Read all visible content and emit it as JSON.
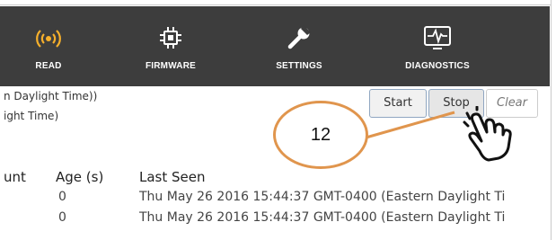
{
  "nav": {
    "items": [
      {
        "label": "READ",
        "icon": "wireless-signal-icon",
        "color": "#f7b02b"
      },
      {
        "label": "FIRMWARE",
        "icon": "chip-icon",
        "color": "#ffffff"
      },
      {
        "label": "SETTINGS",
        "icon": "wrench-icon",
        "color": "#ffffff"
      },
      {
        "label": "DIAGNOSTICS",
        "icon": "monitor-waveform-icon",
        "color": "#ffffff"
      }
    ]
  },
  "timezone_lines": [
    "n Daylight Time))",
    "ight Time)"
  ],
  "buttons": {
    "start_label": "Start",
    "stop_label": "Stop",
    "clear_label": "Clear"
  },
  "callout": {
    "number": "12",
    "border_color": "#e0954d"
  },
  "table": {
    "headers": [
      "unt",
      "Age (s)",
      "Last Seen"
    ],
    "rows": [
      {
        "age": "0",
        "last_seen": "Thu May 26 2016 15:44:37 GMT-0400 (Eastern Daylight Ti"
      },
      {
        "age": "0",
        "last_seen": "Thu May 26 2016 15:44:37 GMT-0400 (Eastern Daylight Ti"
      }
    ]
  },
  "colors": {
    "navbar_bg": "#3d3d3d",
    "read_accent": "#f7b02b",
    "button_border": "#8fa6c1"
  }
}
